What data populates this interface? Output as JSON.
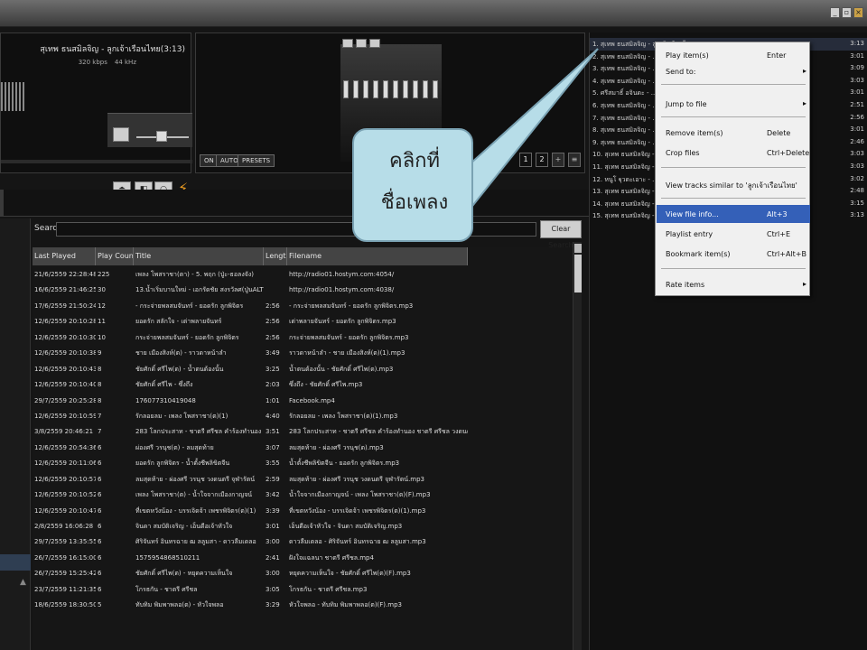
{
  "player": {
    "now_playing": "สุเทพ ธนสมิลจิญ - ลูกเจ้าเรือนไทย(3:13)",
    "bitrate": "320 kbps",
    "samplerate": "44 kHz",
    "controls": [
      "⏏",
      "◧",
      "○"
    ]
  },
  "equalizer": {
    "tabs": [
      "ON",
      "AUTO",
      "PRESETS"
    ]
  },
  "library": {
    "search_label": "Search:",
    "search_value": "",
    "clear_search_label": "Clear Search",
    "columns": [
      "Last Played",
      "Play Count",
      "Title",
      "Length",
      "Filename"
    ],
    "rows": [
      [
        "21/6/2559 22:28:48",
        "225",
        "เพลง โพสราชา(ตา) - 5. พฤก (ปู่ะ-ธอลงจัง)",
        "",
        "http://radio01.hostym.com:4054/"
      ],
      [
        "16/6/2559 21:46:25",
        "30",
        "13.น้ำเริ่มบานใหม่ - เอกรัดชัย สงรวัลศ(ปู่นALT)...",
        "",
        "http://radio01.hostym.com:4038/"
      ],
      [
        "17/6/2559 21:50:24",
        "12",
        "- กระจ่ายพลสมจันทร์ - ยอดรัก ลูกพิจิตร",
        "2:56",
        "- กระจ่ายพลสมจันทร์ - ยอดรัก ลูกพิจิตร.mp3"
      ],
      [
        "12/6/2559 20:10:28",
        "11",
        "ยอดรัก สลักใจ - เต่าพลายจันทร์",
        "2:56",
        "เต่าพลายจันทร์ - ยอดรัก ลูกพิจิตร.mp3"
      ],
      [
        "12/6/2559 20:10:30",
        "10",
        "กระจ่ายพลสมจันทร์ - ยอดรัก ลูกพิจิตร",
        "2:56",
        "กระจ่ายพลสมจันทร์ - ยอดรัก ลูกพิจิตร.mp3"
      ],
      [
        "12/6/2559 20:10:38",
        "9",
        "ชาย เมืองสิงห์(ต) - ราวดาหน้าลำ",
        "3:49",
        "ราวดาหน้าลำ - ชาย เมืองสิงห์(ต)(1).mp3"
      ],
      [
        "12/6/2559 20:10:43",
        "8",
        "ชัยศักดิ์ ศรีไพ(ต) - น้ำตนต้องนั้น",
        "3:25",
        "น้ำตนต้องนั้น - ชัยศักดิ์ ศรีไพ(ต).mp3"
      ],
      [
        "12/6/2559 20:10:40",
        "8",
        "ชัยศักดิ์ ศรีไพ - ซึ่งถึง",
        "2:03",
        "ซึ่งถึง - ชัยศักดิ์ ศรีไพ.mp3"
      ],
      [
        "29/7/2559 20:25:28",
        "8",
        "176077310419048",
        "1:01",
        "Facebook.mp4"
      ],
      [
        "12/6/2559 20:10:59",
        "7",
        "รักลอยลม - เพลง โพสราชา(ต)(1)",
        "4:40",
        "รักลอยลม - เพลง โพสราชา(ต)(1).mp3"
      ],
      [
        "3/8/2559 20:46:21",
        "7",
        "283 โลกประสาท - ชาตรี ศรีชล คำร้องทำนอง ชาตรี...",
        "3:51",
        "283 โลกประสาท - ชาตรี ศรีชล คำร้องทำนอง ชาตรี ศรีชล วงดนตรี ..."
      ],
      [
        "12/6/2559 20:54:36",
        "6",
        "ผ่องศรี วรนุช(ต) - ลมสุดท้าย",
        "3:07",
        "ลมสุดท้าย - ผ่องศรี วรนุช(ต).mp3"
      ],
      [
        "12/6/2559 20:11:06",
        "6",
        "ยอดรัก ลูกพิจิตร - น้ำตั้งชีพลิขิตจีน",
        "3:55",
        "น้ำตั้งชีพลิขิตจีน - ยอดรัก ลูกพิจิตร.mp3"
      ],
      [
        "12/6/2559 20:10:57",
        "6",
        "ลมสุดท้าย - ผ่องศรี วรนุช วงดนตรี จุฬารัตน์",
        "2:59",
        "ลมสุดท้าย - ผ่องศรี วรนุช วงดนตรี จุฬารัตน์.mp3"
      ],
      [
        "12/6/2559 20:10:52",
        "6",
        "เพลง โพสราชา(ต) - น้ำใจจากเมืองกาญจน์",
        "3:42",
        "น้ำใจจากเมืองกาญจน์ - เพลง โพสราชา(ต)(F).mp3"
      ],
      [
        "12/6/2559 20:10:47",
        "6",
        "ที่เขตหวังน้อง - บรรเจิดจ้า เพชรพิจิตร(ต)(1)",
        "3:39",
        "ที่เขตหวังน้อง - บรรเจิดจ้า เพชรพิจิตร(ต)(1).mp3"
      ],
      [
        "2/8/2559 16:06:28",
        "6",
        "จินดา สมบัติเจริญ - เอ็นดีอเจ้าหัวใจ",
        "3:01",
        "เอ็นดีอเจ้าหัวใจ - จินดา สมบัติเจริญ.mp3"
      ],
      [
        "29/7/2559 13:35:55",
        "6",
        "ศิริจันทร์ อินทรฉาย ฒ ลลูมสา - ดาวลืมเดลอ",
        "3:00",
        "ดาวลืมเดลอ - ศิริจันทร์ อินทรฉาย ฒ ลลูมสา.mp3"
      ],
      [
        "26/7/2559 16:15:00",
        "6",
        "1575954868510211",
        "2:41",
        "ฝังใจแฉลนา ชาตรี ศรีชล.mp4"
      ],
      [
        "26/7/2559 15:25:42",
        "6",
        "ชัยศักดิ์ ศรีไพ(ต) - หยุดความเห็นใจ",
        "3:00",
        "หยุดความเห็นใจ - ชัยศักดิ์ ศรีไพ(ต)(F).mp3"
      ],
      [
        "23/7/2559 11:21:35",
        "6",
        "โกรธกัน - ชาตรี ศรีชล",
        "3:05",
        "โกรธกัน - ชาตรี ศรีชล.mp3"
      ],
      [
        "18/6/2559 18:30:50",
        "5",
        "ทับทิม พิมพาพลอ(ต) - หัวใจพลอ",
        "3:29",
        "หัวใจพลอ - ทับทิม พิมพาพลอ(ต)(F).mp3"
      ]
    ]
  },
  "playlist": {
    "items": [
      {
        "title": "1. สุเทพ ธนสมิลจิญ - ลูกเจ้าเรือนไทย",
        "time": "3:13"
      },
      {
        "title": "2. สุเทพ ธนสมิลจิญ - ...",
        "time": "3:01"
      },
      {
        "title": "3. สุเทพ ธนสมิลจิญ - ...",
        "time": "3:09"
      },
      {
        "title": "4. สุเทพ ธนสมิลจิญ - ...",
        "time": "3:03"
      },
      {
        "title": "5. ศรีสมาธิ์ อจินดะ - ...",
        "time": "3:01"
      },
      {
        "title": "6. สุเทพ ธนสมิลจิญ - ...",
        "time": "2:51"
      },
      {
        "title": "7. สุเทพ ธนสมิลจิญ - ...",
        "time": "2:56"
      },
      {
        "title": "8. สุเทพ ธนสมิลจิญ - ...",
        "time": "3:01"
      },
      {
        "title": "9. สุเทพ ธนสมิลจิญ - ...",
        "time": "2:46"
      },
      {
        "title": "10. สุเทพ ธนสมิลจิญ - ...",
        "time": "3:03"
      },
      {
        "title": "11. สุเทพ ธนสมิลจิญ - ...",
        "time": "3:03"
      },
      {
        "title": "12. หนูโ ฐุวดะเอาะ - ...",
        "time": "3:02"
      },
      {
        "title": "13. สุเทพ ธนสมิลจิญ - ...",
        "time": "2:48"
      },
      {
        "title": "14. สุเทพ ธนสมิลจิญ - ...",
        "time": "3:15"
      },
      {
        "title": "15. สุเทพ ธนสมิลจิญ - ...",
        "time": "3:13"
      }
    ]
  },
  "context_menu": {
    "items": [
      {
        "label": "Play item(s)",
        "shortcut": "Enter"
      },
      {
        "label": "Send to:",
        "submenu": "▸"
      },
      {
        "label": "Jump to file",
        "submenu": "▸"
      },
      {
        "label": "Remove item(s)",
        "shortcut": "Delete"
      },
      {
        "label": "Crop files",
        "shortcut": "Ctrl+Delete"
      },
      {
        "label": "View tracks similar to 'ลูกเจ้าเรือนไทย'"
      },
      {
        "label": "View file info...",
        "shortcut": "Alt+3"
      },
      {
        "label": "Playlist entry",
        "shortcut": "Ctrl+E"
      },
      {
        "label": "Bookmark item(s)",
        "shortcut": "Ctrl+Alt+B"
      },
      {
        "label": "Rate items",
        "submenu": "▸"
      }
    ]
  },
  "callout": {
    "line1": "คลิกที่",
    "line2": "ชื่อเพลง"
  },
  "colors": {
    "highlight": "#3460b8",
    "callout_fill": "#b7dde8",
    "accent_bolt": "#e89a20"
  }
}
